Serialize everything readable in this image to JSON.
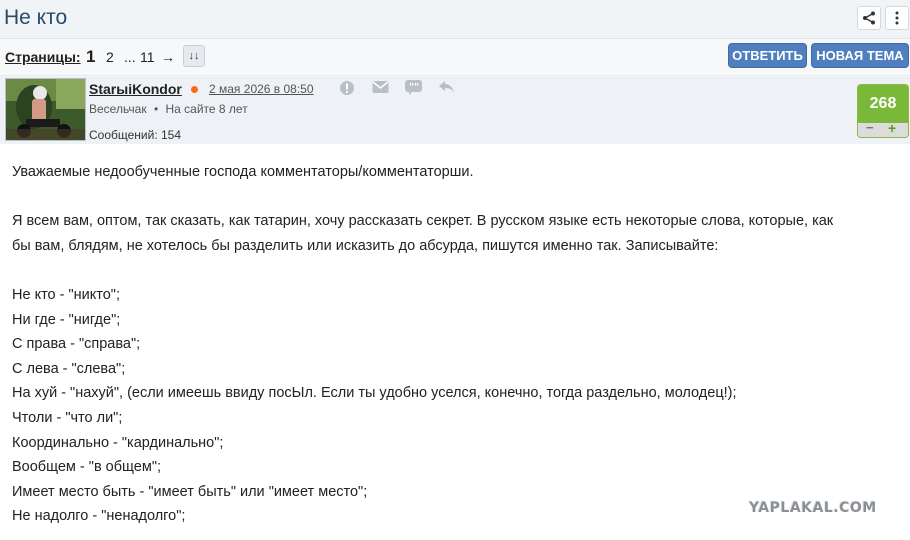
{
  "topic": {
    "title": "Не кто"
  },
  "pagination": {
    "label": "Страницы:",
    "current": "1",
    "page2": "2",
    "ellipsis": "...",
    "last": "11",
    "next": "→",
    "sort_icon": "↓↓"
  },
  "actions": {
    "reply": "ОТВЕТИТЬ",
    "new_topic": "НОВАЯ ТЕМА",
    "share_icon": "share-icon",
    "menu_icon": "more-vertical-icon"
  },
  "post": {
    "author": "StarыiKondor",
    "date": "2 мая 2026 в 08:50",
    "rank": "Весельчак",
    "separator": "•",
    "on_site": "На сайте 8 лет",
    "messages": "Сообщений: 154",
    "rating": "268",
    "minus": "−",
    "plus": "+",
    "lines": [
      "Уважаемые недообученные господа комментаторы/комментаторши.",
      "",
      "Я всем вам, оптом, так сказать, как татарин, хочу рассказать секрет. В русском языке есть некоторые слова, которые, как",
      "бы вам, блядям, не хотелось бы разделить или исказить до абсурда, пишутся именно так. Записывайте:",
      "",
      "Не кто - \"никто\";",
      "Ни где - \"нигде\";",
      "С права - \"справа\";",
      "С лева - \"слева\";",
      "На хуй - \"нахуй\", (если имеешь ввиду посЫл. Если ты удобно уселся, конечно, тогда раздельно, молодец!);",
      "Чтоли - \"что ли\";",
      "Координально - \"кардинально\";",
      "Вообщем - \"в общем\";",
      "Имеет место быть - \"имеет быть\" или \"имеет место\";",
      "Не надолго - \"ненадолго\";"
    ]
  },
  "watermark": "YAPLAKAL.COM"
}
